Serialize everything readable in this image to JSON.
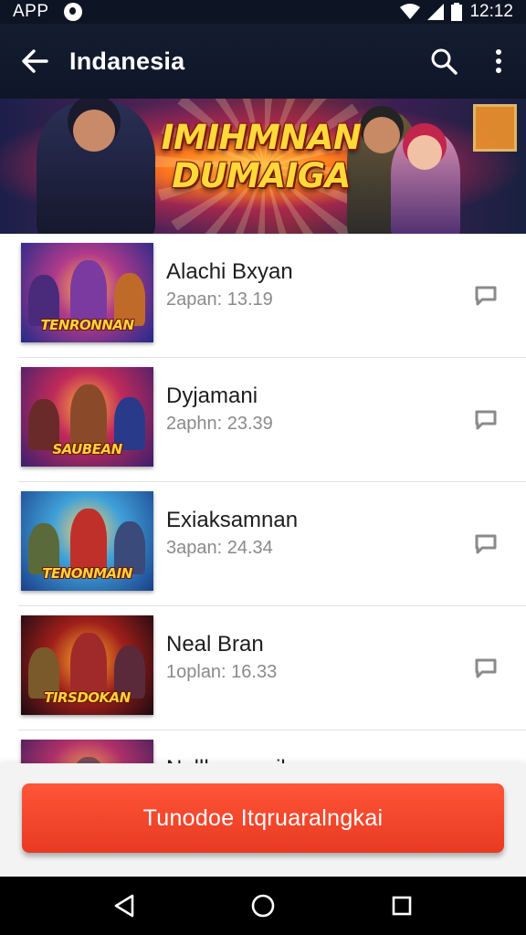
{
  "status_bar": {
    "app_label": "APP",
    "time": "12:12"
  },
  "app_bar": {
    "title": "Indanesia",
    "icons": [
      "back-arrow-icon",
      "search-icon",
      "more-vert-icon"
    ]
  },
  "banner": {
    "title_line1": "IMIHMNAN",
    "title_line2": "DUMAIGA"
  },
  "list": {
    "items": [
      {
        "name": "Alachi Bxyan",
        "meta": "2apan: 13.19",
        "thumb_logo": "TENRONNAN",
        "colors": [
          "#2a2f8f",
          "#7b2fa0",
          "#ff8c2a"
        ]
      },
      {
        "name": "Dyjamani",
        "meta": "2aphn: 23.39",
        "thumb_logo": "SAUBEAN",
        "colors": [
          "#3b1f6e",
          "#c02a5a",
          "#ff9d2f"
        ]
      },
      {
        "name": "Exiaksamnan",
        "meta": "3apan: 24.34",
        "thumb_logo": "TENONMAIN",
        "colors": [
          "#1b3f8a",
          "#3fa0d8",
          "#e83f2a"
        ]
      },
      {
        "name": "Neal Bran",
        "meta": "1oplan: 16.33",
        "thumb_logo": "TIRSDOKAN",
        "colors": [
          "#2a0f12",
          "#a01f1a",
          "#ffb12a"
        ]
      },
      {
        "name": "Nallhoezaoil",
        "meta": "",
        "thumb_logo": "",
        "colors": [
          "#3a1f5a",
          "#b0306a",
          "#ff8c2a"
        ]
      }
    ]
  },
  "cta": {
    "label": "Tunodoe Itqruaralngkai"
  },
  "colors": {
    "app_bar": "#141c31",
    "accent": "#f0442a",
    "nav": "#000000"
  }
}
